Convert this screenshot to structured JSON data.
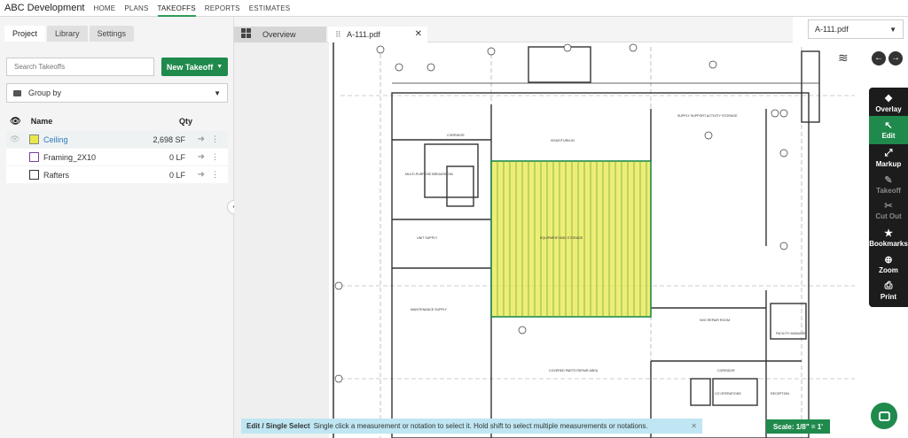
{
  "app": {
    "brand": "ABC Development",
    "nav": [
      "HOME",
      "PLANS",
      "TAKEOFFS",
      "REPORTS",
      "ESTIMATES"
    ],
    "active_nav": "TAKEOFFS"
  },
  "left_panel": {
    "tabs": [
      "Project",
      "Library",
      "Settings"
    ],
    "search_placeholder": "Search Takeoffs",
    "new_takeoff": "New Takeoff",
    "group_by": "Group by",
    "columns": {
      "name": "Name",
      "qty": "Qty"
    },
    "rows": [
      {
        "name": "Ceiling",
        "qty": "2,698 SF",
        "color": "#e8e84a"
      },
      {
        "name": "Framing_2X10",
        "qty": "0 LF",
        "color": "#7a3fa0"
      },
      {
        "name": "Rafters",
        "qty": "0 LF",
        "color": "#333333"
      }
    ]
  },
  "doc_tabs": {
    "overview": "Overview",
    "active_file": "A-111.pdf",
    "selector": "A-111.pdf"
  },
  "tools": [
    {
      "label": "Overlay",
      "icon": "overlay-icon",
      "state": "normal"
    },
    {
      "label": "Edit",
      "icon": "pointer-icon",
      "state": "active"
    },
    {
      "label": "Markup",
      "icon": "markup-icon",
      "state": "normal"
    },
    {
      "label": "Takeoff",
      "icon": "takeoff-icon",
      "state": "disabled"
    },
    {
      "label": "Cut Out",
      "icon": "cutout-icon",
      "state": "disabled"
    },
    {
      "label": "Bookmarks",
      "icon": "star-icon",
      "state": "normal"
    },
    {
      "label": "Zoom",
      "icon": "zoom-icon",
      "state": "normal"
    },
    {
      "label": "Print",
      "icon": "print-icon",
      "state": "normal"
    }
  ],
  "hint": {
    "mode": "Edit / Single Select",
    "text": "Single click a measurement or notation to select it. Hold shift to select multiple measurements or notations."
  },
  "scale": "Scale: 1/8\" = 1'",
  "plan_labels": {
    "room1": "MULTI-PURPOSE BREAKROOM",
    "room2": "CORRIDOR",
    "room3": "UNIT SUPPLY",
    "room4": "MAINTENANCE SUPPLY",
    "room5": "EQUIPMENT AND STORAGE",
    "room6": "NVG REPAIR ROOM",
    "room7": "SUPPLY SUPPORT ACTIVITY STORAGE",
    "room8": "COVERED PARTS REPAIR AREA",
    "room9": "CORRIDOR",
    "room10": "CO OPERATIONS",
    "room11": "RECEPTION",
    "room12": "FACILITY MANAGER",
    "room13": "ISSUE/TURN-IN"
  },
  "colors": {
    "accent": "#1f8a4c",
    "hatch": "#e8e84a",
    "hint_bg": "#bfe6f2"
  }
}
